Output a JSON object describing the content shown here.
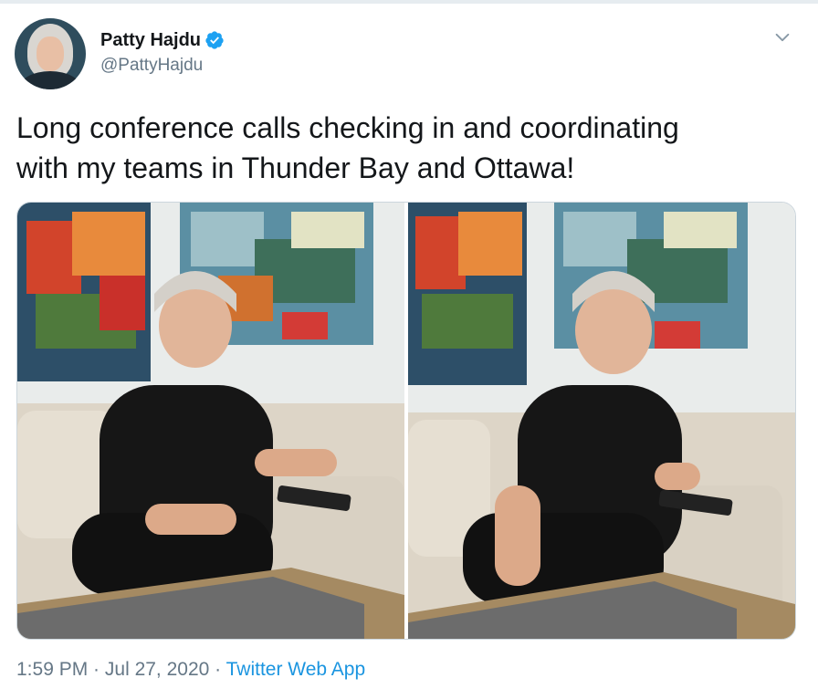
{
  "author": {
    "name": "Patty Hajdu",
    "handle": "@PattyHajdu",
    "verified": true,
    "avatar": "profile-photo"
  },
  "tweet": {
    "text": "Long conference calls checking in and coordinating\nwith my teams in Thunder Bay and Ottawa!"
  },
  "media": [
    {
      "name": "photo-left",
      "content": "woman-on-couch-with-phone"
    },
    {
      "name": "photo-right",
      "content": "woman-smiling-on-couch"
    }
  ],
  "meta": {
    "time": "1:59 PM",
    "separator": " · ",
    "date": "Jul 27, 2020",
    "app": "Twitter Web App"
  },
  "icons": {
    "verified": "verified-badge-icon",
    "menu": "chevron-down-icon"
  },
  "colors": {
    "accent": "#1da1f2",
    "link": "#1b95e0",
    "text": "#14171a",
    "secondary": "#657786",
    "border": "#ccd6dd"
  }
}
